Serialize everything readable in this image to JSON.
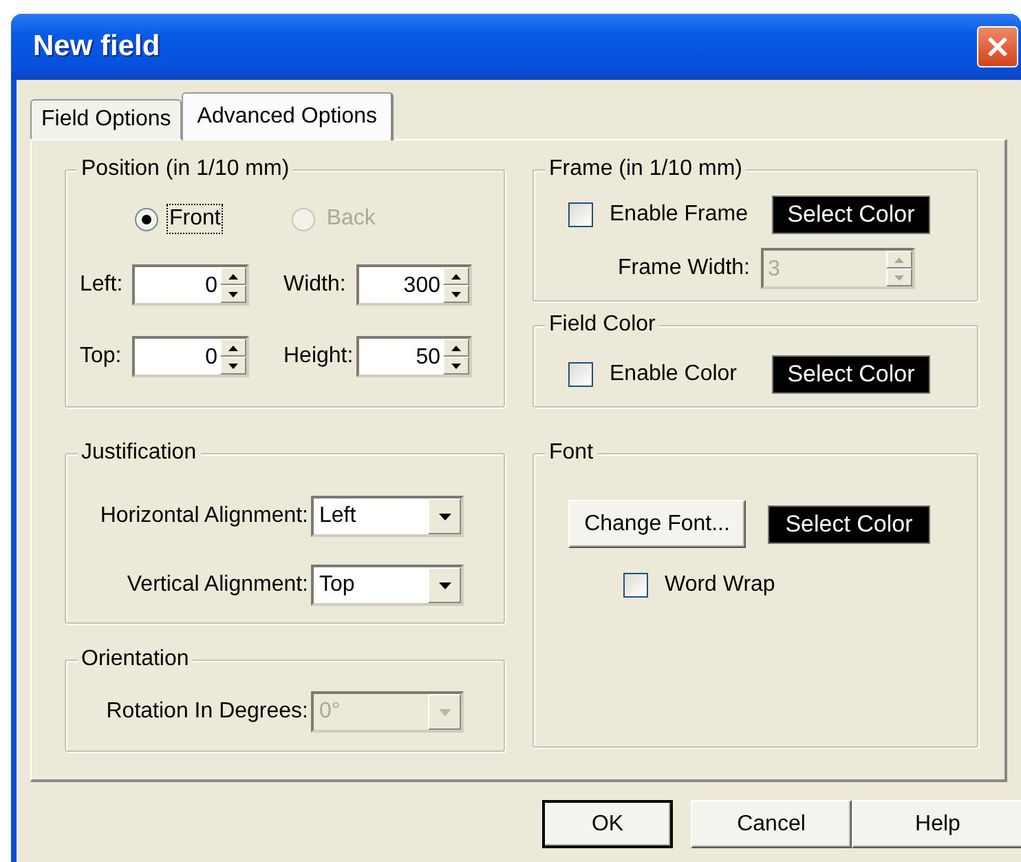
{
  "window": {
    "title": "New field"
  },
  "tabs": [
    {
      "label": "Field Options",
      "selected": false
    },
    {
      "label": "Advanced Options",
      "selected": true
    }
  ],
  "position": {
    "title": "Position (in 1/10 mm)",
    "radios": [
      {
        "label": "Front",
        "selected": true,
        "disabled": false,
        "focused": true
      },
      {
        "label": "Back",
        "selected": false,
        "disabled": true,
        "focused": false
      }
    ],
    "fields": [
      {
        "label": "Left:",
        "value": "0"
      },
      {
        "label": "Width:",
        "value": "300"
      },
      {
        "label": "Top:",
        "value": "0"
      },
      {
        "label": "Height:",
        "value": "50"
      }
    ]
  },
  "justification": {
    "title": "Justification",
    "dropdowns": [
      {
        "label": "Horizontal Alignment:",
        "value": "Left"
      },
      {
        "label": "Vertical Alignment:",
        "value": "Top"
      }
    ]
  },
  "orientation": {
    "title": "Orientation",
    "dropdown": {
      "label": "Rotation In Degrees:",
      "value": "0°",
      "disabled": true
    }
  },
  "frame": {
    "title": "Frame (in 1/10 mm)",
    "checkbox": {
      "label": "Enable Frame",
      "checked": false
    },
    "color_button": "Select Color",
    "width_field": {
      "label": "Frame Width:",
      "value": "3",
      "disabled": true
    }
  },
  "field_color": {
    "title": "Field Color",
    "checkbox": {
      "label": "Enable Color",
      "checked": false
    },
    "color_button": "Select Color"
  },
  "font": {
    "title": "Font",
    "change_font_button": "Change Font...",
    "color_button": "Select Color",
    "checkbox": {
      "label": "Word Wrap",
      "checked": false
    }
  },
  "buttons": [
    {
      "label": "OK",
      "default": true
    },
    {
      "label": "Cancel",
      "default": false
    },
    {
      "label": "Help",
      "default": false
    }
  ]
}
